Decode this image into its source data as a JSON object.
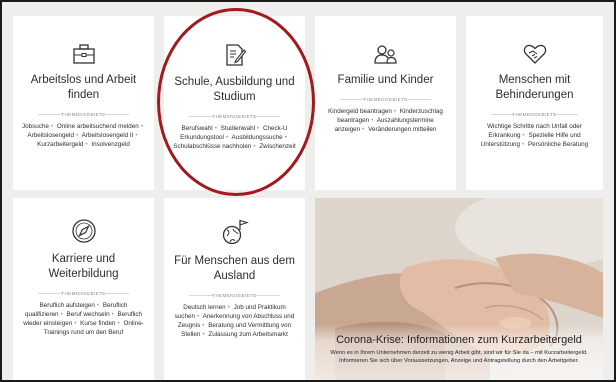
{
  "kicker_label": "THEMENGEBIETE",
  "tiles": [
    {
      "icon": "briefcase-icon",
      "title": "Arbeitslos und Arbeit finden",
      "links": [
        "Jobsuche",
        "Online arbeitsuchend melden",
        "Arbeitslosengeld",
        "Arbeitslosengeld II",
        "Kurzarbeitergeld",
        "Insolvenzgeld"
      ]
    },
    {
      "icon": "document-pen-icon",
      "title": "Schule, Ausbildung und Studium",
      "links": [
        "Berufswahl",
        "Studienwahl",
        "Check-U Erkundungstool",
        "Ausbildungssuche",
        "Schulabschlüsse nachholen",
        "Zwischenzeit"
      ]
    },
    {
      "icon": "family-icon",
      "title": "Familie und Kinder",
      "links": [
        "Kindergeld beantragen",
        "Kinderzuschlag beantragen",
        "Auszahlungstermine anzeigen",
        "Veränderungen mitteilen"
      ]
    },
    {
      "icon": "handshake-heart-icon",
      "title": "Menschen mit Behinderungen",
      "links": [
        "Wichtige Schritte nach Unfall oder Erkrankung",
        "Spezielle Hilfe und Unterstützung",
        "Persönliche Beratung"
      ]
    },
    {
      "icon": "compass-icon",
      "title": "Karriere und Weiterbildung",
      "links": [
        "Beruflich aufsteigen",
        "Beruflich qualifizieren",
        "Beruf wechseln",
        "Beruflich wieder einsteigen",
        "Kurse finden",
        "Online-Trainings rund um den Beruf"
      ]
    },
    {
      "icon": "globe-flag-icon",
      "title": "Für Menschen aus dem Ausland",
      "links": [
        "Deutsch lernen",
        "Job und Praktikum suchen",
        "Anerkennung von Abschluss und Zeugnis",
        "Beratung und Vermittlung von Stellen",
        "Zulassung zum Arbeitsmarkt"
      ]
    }
  ],
  "feature": {
    "title": "Corona-Krise: Informationen zum Kurzarbeitergeld",
    "text": "Wenn es in Ihrem Unternehmen derzeit zu wenig Arbeit gibt, sind wir für Sie da – mit Kurzarbeitergeld. Informieren Sie sich über Voraussetzungen, Anzeige und Antragstellung durch den Arbeitgeber."
  },
  "colors": {
    "highlight": "#a3191f",
    "tile_bg": "#ffffff",
    "page_bg": "#eeeeec"
  }
}
